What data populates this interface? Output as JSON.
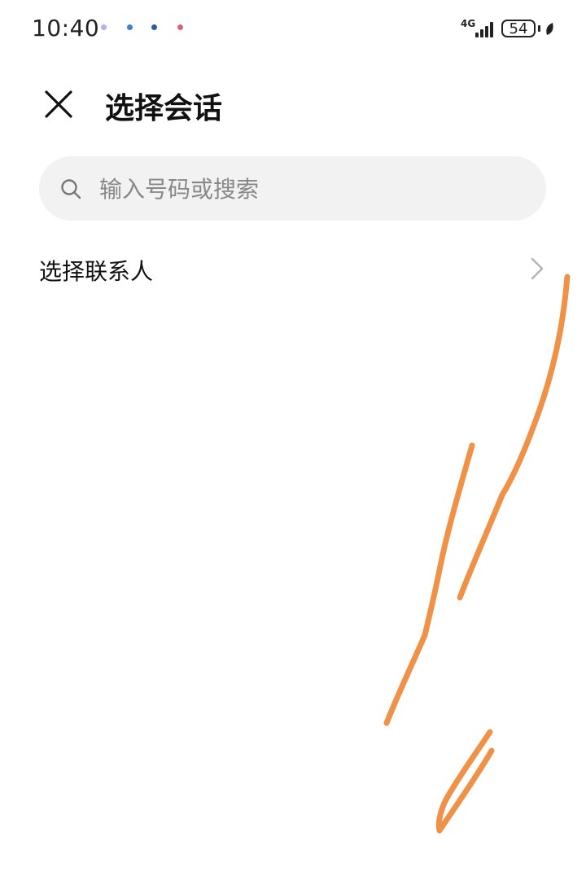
{
  "status_bar": {
    "time": "10:40",
    "network": "4G",
    "battery": "54"
  },
  "header": {
    "title": "选择会话",
    "close_icon": "close-icon"
  },
  "search": {
    "placeholder": "输入号码或搜索",
    "value": "",
    "icon": "search-icon"
  },
  "list": {
    "select_contact_label": "选择联系人",
    "chevron_icon": "chevron-right-icon"
  },
  "colors": {
    "background": "#ffffff",
    "search_bg": "#f2f2f2",
    "placeholder": "#888888",
    "scribble": "#ef9248"
  }
}
